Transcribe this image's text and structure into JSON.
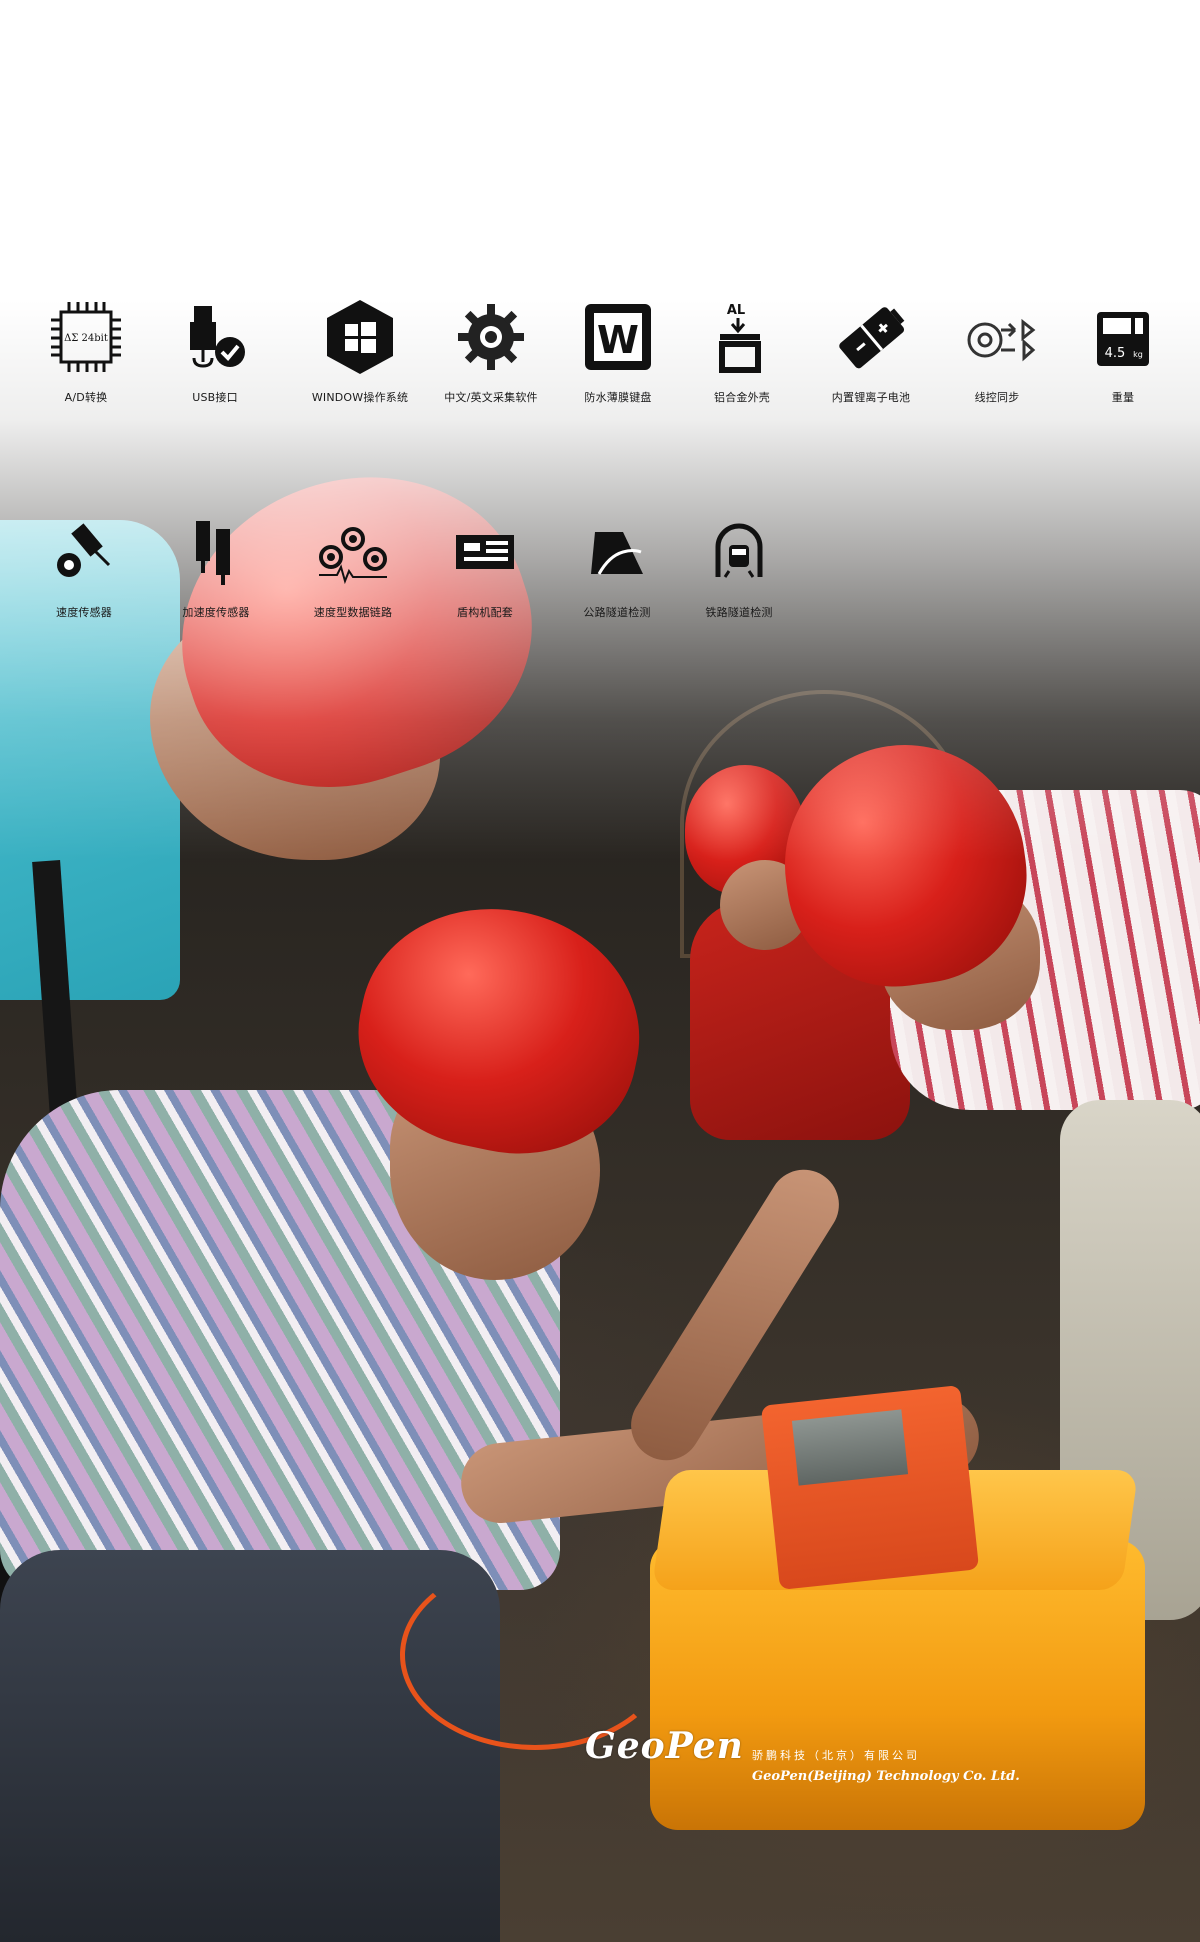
{
  "features_row1": [
    {
      "icon": "ad-converter-chip-icon",
      "label": "A/D转换",
      "chip_text": "ΔΣ 24bit"
    },
    {
      "icon": "usb-icon",
      "label": "USB接口"
    },
    {
      "icon": "windows-icon",
      "label": "WINDOW操作系统"
    },
    {
      "icon": "gear-software-icon",
      "label": "中文/英文采集软件"
    },
    {
      "icon": "keyboard-w-icon",
      "label": "防水薄膜键盘",
      "key_text": "W"
    },
    {
      "icon": "aluminum-case-icon",
      "label": "铝合金外壳",
      "badge_text": "AL"
    },
    {
      "icon": "battery-icon",
      "label": "内置锂离子电池"
    },
    {
      "icon": "wired-sync-icon",
      "label": "线控同步"
    },
    {
      "icon": "weight-scale-icon",
      "label": "重量",
      "weight_value": "4.5",
      "weight_unit": "kg"
    }
  ],
  "features_row2": [
    {
      "icon": "velocity-sensor-icon",
      "label": "速度传感器"
    },
    {
      "icon": "accelerometer-icon",
      "label": "加速度传感器"
    },
    {
      "icon": "velocity-data-link-icon",
      "label": "速度型数据链路"
    },
    {
      "icon": "shield-machine-icon",
      "label": "盾构机配套"
    },
    {
      "icon": "road-tunnel-icon",
      "label": "公路隧道检测"
    },
    {
      "icon": "rail-tunnel-icon",
      "label": "铁路隧道检测"
    }
  ],
  "brand": {
    "logo": "GeoPen",
    "company_cn": "骄鹏科技（北京）有限公司",
    "company_en": "GeoPen(Beijing) Technology Co. Ltd."
  }
}
